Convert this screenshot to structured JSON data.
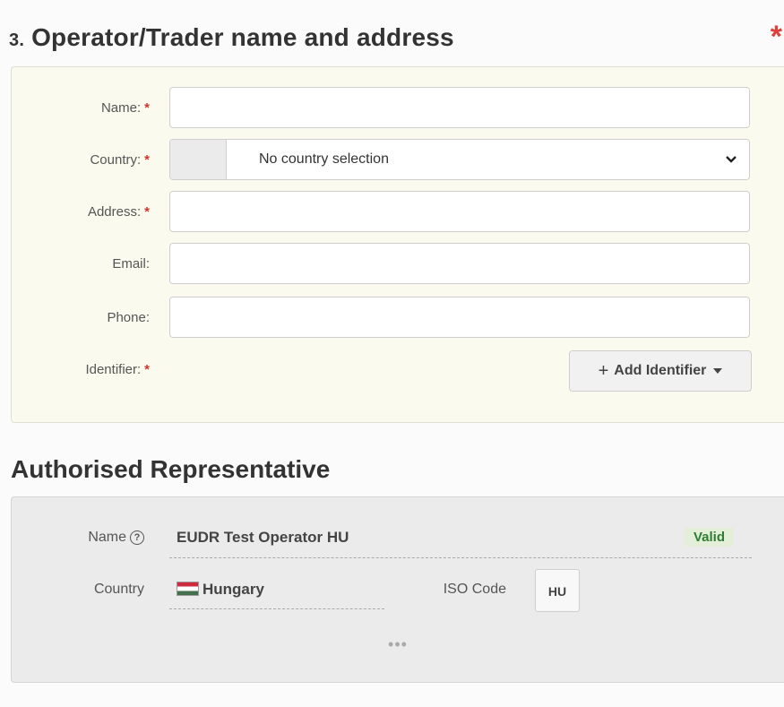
{
  "operator_section": {
    "number": "3.",
    "title": "Operator/Trader name and address",
    "required_marker": "*",
    "required_star": "*",
    "fields": {
      "name": {
        "label": "Name:",
        "value": "",
        "placeholder": ""
      },
      "country": {
        "label": "Country:",
        "selected": "No country selection"
      },
      "address": {
        "label": "Address:",
        "value": "",
        "placeholder": ""
      },
      "email": {
        "label": "Email:",
        "value": "",
        "placeholder": ""
      },
      "phone": {
        "label": "Phone:",
        "value": "",
        "placeholder": ""
      },
      "identifier": {
        "label": "Identifier:"
      }
    },
    "add_identifier_button": {
      "plus": "+",
      "label": "Add Identifier"
    }
  },
  "authorised_representative": {
    "title": "Authorised Representative",
    "name_label": "Name",
    "help_glyph": "?",
    "name_value": "EUDR Test Operator HU",
    "status": "Valid",
    "country_label": "Country",
    "country_value": "Hungary",
    "iso_label": "ISO Code",
    "iso_value": "HU",
    "more": "•••"
  },
  "colors": {
    "required": "#d0342c",
    "panel_bg": "#fbfaee",
    "valid_bg": "#e3efd9",
    "valid_text": "#2f7d32"
  }
}
